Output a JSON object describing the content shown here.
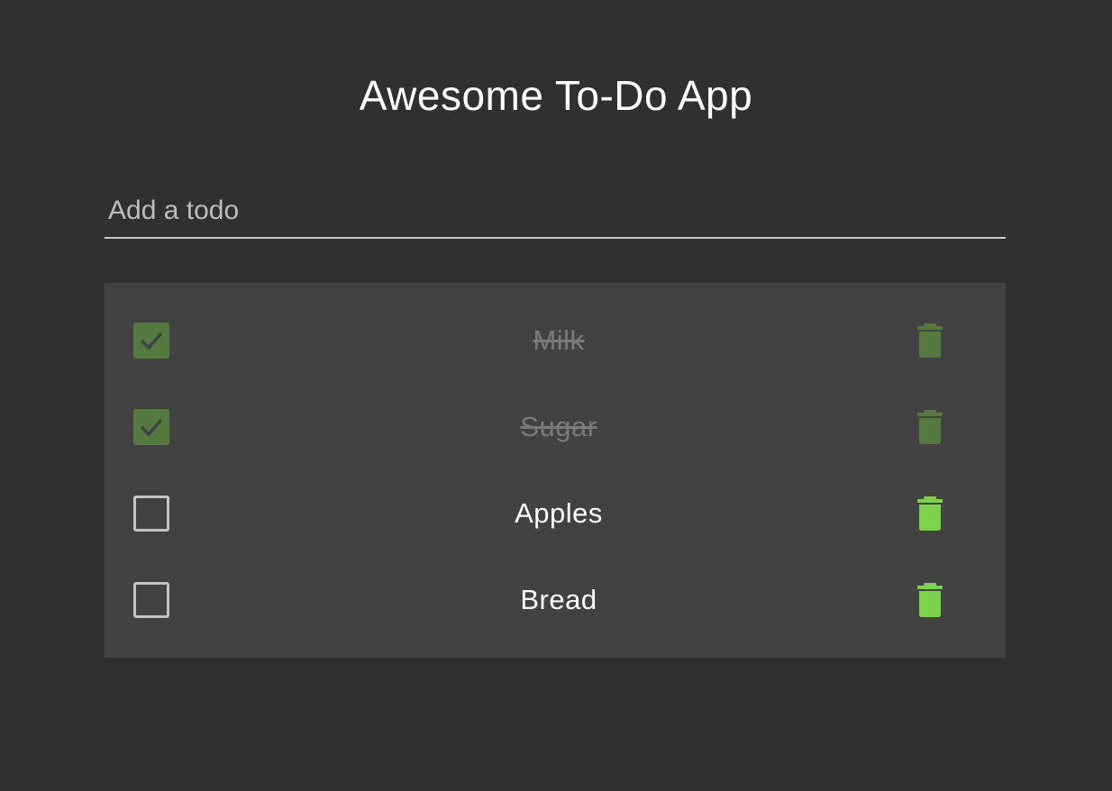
{
  "app": {
    "title": "Awesome To-Do App"
  },
  "input": {
    "placeholder": "Add a todo",
    "value": ""
  },
  "colors": {
    "background": "#303030",
    "list_background": "#424242",
    "accent_green": "#7ed14d",
    "done_green": "#557a3f",
    "done_text": "#7a7a7a"
  },
  "todos": [
    {
      "label": "Milk",
      "done": true,
      "delete_icon": "trash-icon"
    },
    {
      "label": "Sugar",
      "done": true,
      "delete_icon": "trash-icon"
    },
    {
      "label": "Apples",
      "done": false,
      "delete_icon": "trash-icon"
    },
    {
      "label": "Bread",
      "done": false,
      "delete_icon": "trash-icon"
    }
  ]
}
